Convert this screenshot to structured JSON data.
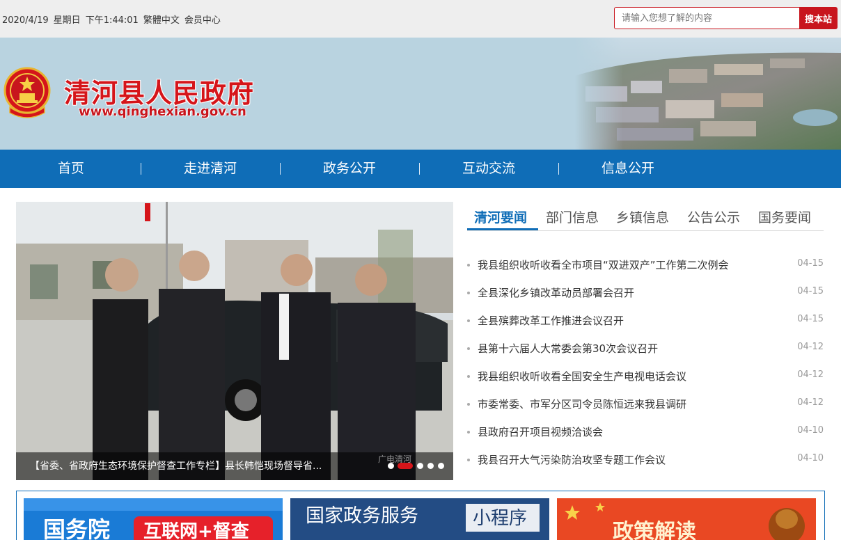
{
  "topbar": {
    "date": "2020/4/19",
    "weekday": "星期日",
    "time": "下午1:44:01",
    "traditional_link": "繁體中文",
    "member_link": "会员中心"
  },
  "search": {
    "placeholder": "请输入您想了解的内容",
    "button_label": "搜本站"
  },
  "header": {
    "site_title": "清河县人民政府",
    "site_url": "www.qinghexian.gov.cn"
  },
  "nav": {
    "items": [
      {
        "label": "首页"
      },
      {
        "label": "走进清河"
      },
      {
        "label": "政务公开"
      },
      {
        "label": "互动交流"
      },
      {
        "label": "信息公开"
      }
    ]
  },
  "slider": {
    "caption": "【省委、省政府生态环境保护督查工作专栏】县长韩恺现场督导省...",
    "watermark": "广电清河",
    "dots": 5,
    "active_index": 1
  },
  "news": {
    "tabs": [
      {
        "label": "清河要闻",
        "active": true
      },
      {
        "label": "部门信息"
      },
      {
        "label": "乡镇信息"
      },
      {
        "label": "公告公示"
      },
      {
        "label": "国务要闻"
      }
    ],
    "items": [
      {
        "title": "我县组织收听收看全市项目“双进双产”工作第二次例会",
        "date": "04-15"
      },
      {
        "title": "全县深化乡镇改革动员部署会召开",
        "date": "04-15"
      },
      {
        "title": "全县殡葬改革工作推进会议召开",
        "date": "04-15"
      },
      {
        "title": "县第十六届人大常委会第30次会议召开",
        "date": "04-12"
      },
      {
        "title": "我县组织收听收看全国安全生产电视电话会议",
        "date": "04-12"
      },
      {
        "title": "市委常委、市军分区司令员陈恒远来我县调研",
        "date": "04-12"
      },
      {
        "title": "县政府召开项目视频洽谈会",
        "date": "04-10"
      },
      {
        "title": "我县召开大气污染防治攻坚专题工作会议",
        "date": "04-10"
      }
    ]
  },
  "promo": {
    "cards": [
      {
        "title": "国务院",
        "subtitle": "互联网+督查"
      },
      {
        "title": "国家政务服务",
        "subtitle": "小程序"
      },
      {
        "title": "政策解读"
      }
    ]
  },
  "colors": {
    "brand_red": "#c8151d",
    "nav_blue": "#0f6db7",
    "banner_bg": "#b9d3e0"
  }
}
